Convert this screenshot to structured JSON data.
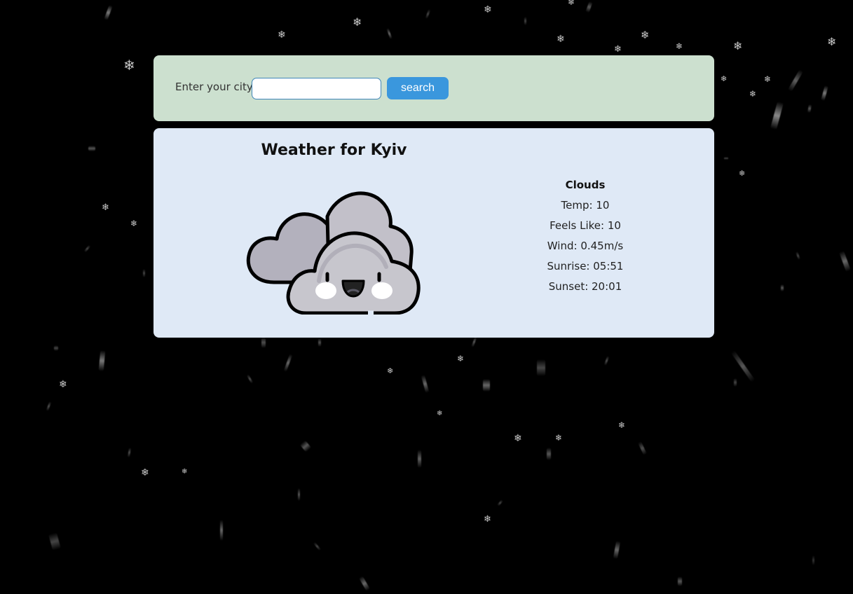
{
  "search": {
    "label": "Enter your city",
    "value": "",
    "placeholder": "",
    "button_label": "search"
  },
  "weather": {
    "title": "Weather for Kyiv",
    "icon": "cloudy-face-icon",
    "condition": "Clouds",
    "temp": "Temp: 10",
    "feels_like": "Feels Like: 10",
    "wind": "Wind: 0.45m/s",
    "sunrise": "Sunrise: 05:51",
    "sunset": "Sunset: 20:01"
  },
  "colors": {
    "page_background": "#000000",
    "search_panel": "#cce0cf",
    "weather_card": "#dfe9f6",
    "button": "#3a97dd"
  }
}
